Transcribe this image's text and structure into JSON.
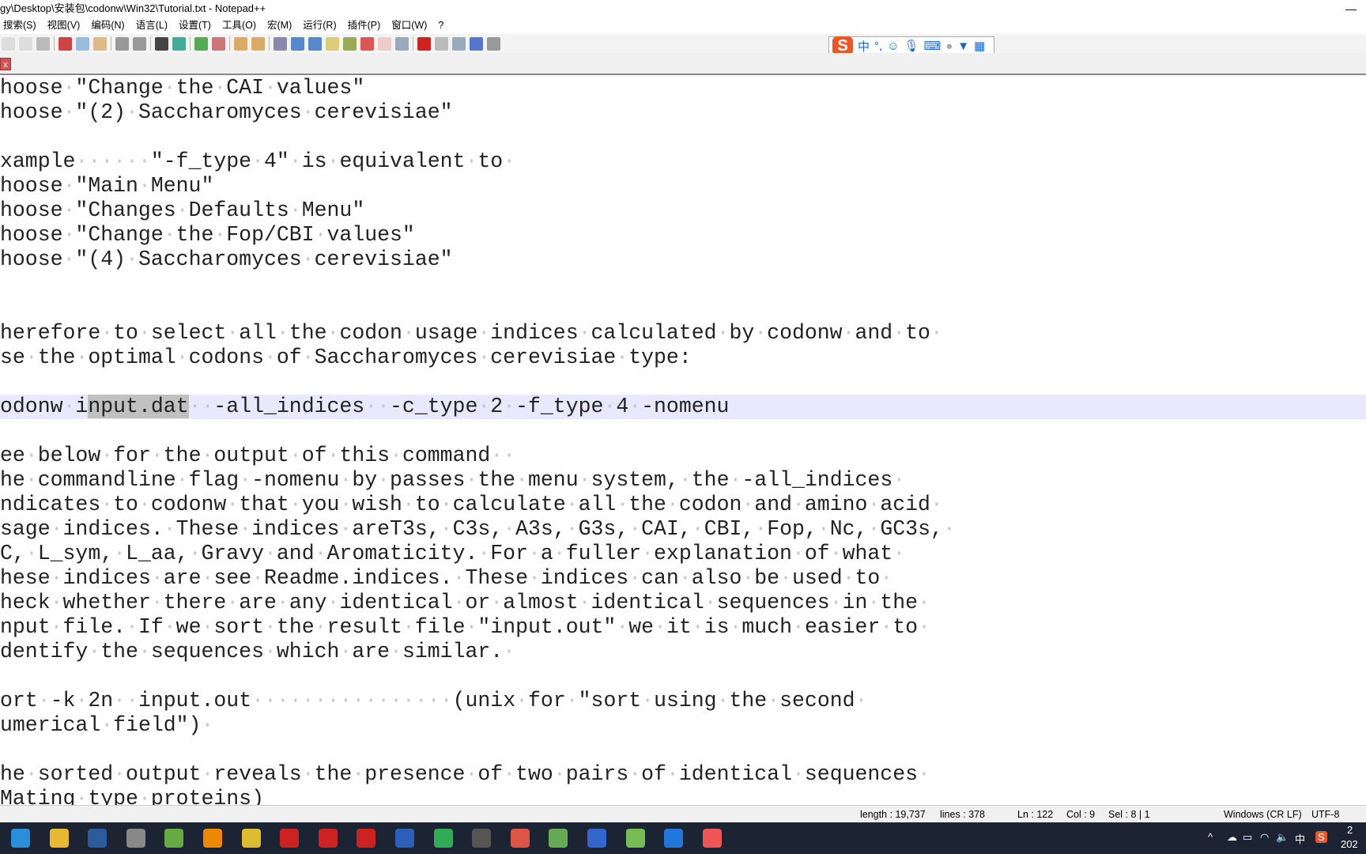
{
  "window": {
    "title": "gy\\Desktop\\安装包\\codonw\\Win32\\Tutorial.txt - Notepad++",
    "minimize": "—"
  },
  "menu": [
    "搜索(S)",
    "视图(V)",
    "编码(N)",
    "语言(L)",
    "设置(T)",
    "工具(O)",
    "宏(M)",
    "运行(R)",
    "插件(P)",
    "窗口(W)",
    "?"
  ],
  "ime": {
    "logo": "S",
    "mode": "中",
    "punct": "°,",
    "icons": [
      "emoji-icon",
      "microphone-icon",
      "keyboard-icon",
      "user-icon",
      "skin-icon",
      "grid-icon"
    ]
  },
  "editor": {
    "lines": [
      "hoose \"Change the CAI values\"",
      "hoose \"(2) Saccharomyces cerevisiae\"",
      "",
      "xample      \"-f_type 4\" is equivalent to ",
      "hoose \"Main Menu\"",
      "hoose \"Changes Defaults Menu\"",
      "hoose \"Change the Fop/CBI values\"",
      "hoose \"(4) Saccharomyces cerevisiae\"",
      "",
      "",
      "herefore to select all the codon usage indices calculated by codonw and to ",
      "se the optimal codons of Saccharomyces cerevisiae type:",
      "",
      "odonw input.dat  -all_indices  -c_type 2 -f_type 4 -nomenu",
      "",
      "ee below for the output of this command  ",
      "he commandline flag -nomenu by passes the menu system, the -all_indices ",
      "ndicates to codonw that you wish to calculate all the codon and amino acid ",
      "sage indices. These indices areT3s, C3s, A3s, G3s, CAI, CBI, Fop, Nc, GC3s, ",
      "C, L_sym, L_aa, Gravy and Aromaticity. For a fuller explanation of what ",
      "hese indices are see Readme.indices. These indices can also be used to ",
      "heck whether there are any identical or almost identical sequences in the ",
      "nput file. If we sort the result file \"input.out\" we it is much easier to ",
      "dentify the sequences which are similar. ",
      "",
      "ort -k 2n  input.out                (unix for \"sort using the second ",
      "umerical field\") ",
      "",
      "he sorted output reveals the presence of two pairs of identical sequences ",
      "Mating type proteins)"
    ],
    "current_line_index": 13,
    "selection": "nput.dat"
  },
  "status": {
    "length": "length : 19,737",
    "lines": "lines : 378",
    "ln": "Ln : 122",
    "col": "Col : 9",
    "sel": "Sel : 8 | 1",
    "eol": "Windows (CR LF)",
    "encoding": "UTF-8"
  },
  "taskbar": {
    "apps": [
      "edge",
      "file-explorer",
      "language-en",
      "app",
      "app",
      "search",
      "chrome",
      "youdao",
      "app",
      "acrobat",
      "word",
      "app",
      "ipy",
      "app",
      "app",
      "r",
      "notepad++",
      "app",
      "app"
    ],
    "tray": {
      "chevron": "^",
      "ime": "中",
      "clock_partial": "2",
      "date_partial": "202"
    }
  },
  "colors": {
    "current_line": "#e8e8ff",
    "selection": "#c0c0c0",
    "taskbar": "#1c2433"
  }
}
